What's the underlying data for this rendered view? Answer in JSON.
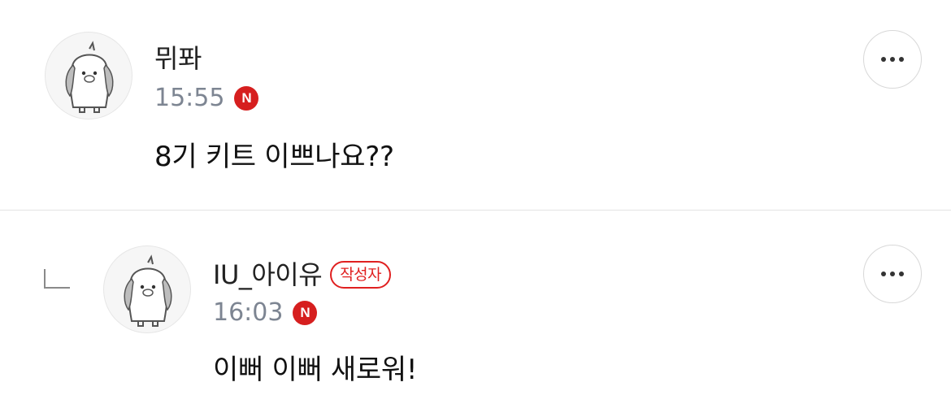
{
  "comments": [
    {
      "author": "뮈퐈",
      "time": "15:55",
      "platform_badge": "N",
      "text": "8기 키트 이쁘나요??",
      "more_icon": "more-horizontal-icon",
      "avatar_icon": "penguin-avatar-icon"
    },
    {
      "author": "IU_아이유",
      "author_badge": "작성자",
      "time": "16:03",
      "platform_badge": "N",
      "text": "이뻐 이뻐 새로워!",
      "more_icon": "more-horizontal-icon",
      "avatar_icon": "penguin-avatar-icon",
      "reply_icon": "reply-corner-icon"
    }
  ],
  "colors": {
    "badge_red": "#d61f1f",
    "author_badge_red": "#e02020",
    "time_gray": "#7d8592",
    "divider": "#e4e4e4"
  }
}
